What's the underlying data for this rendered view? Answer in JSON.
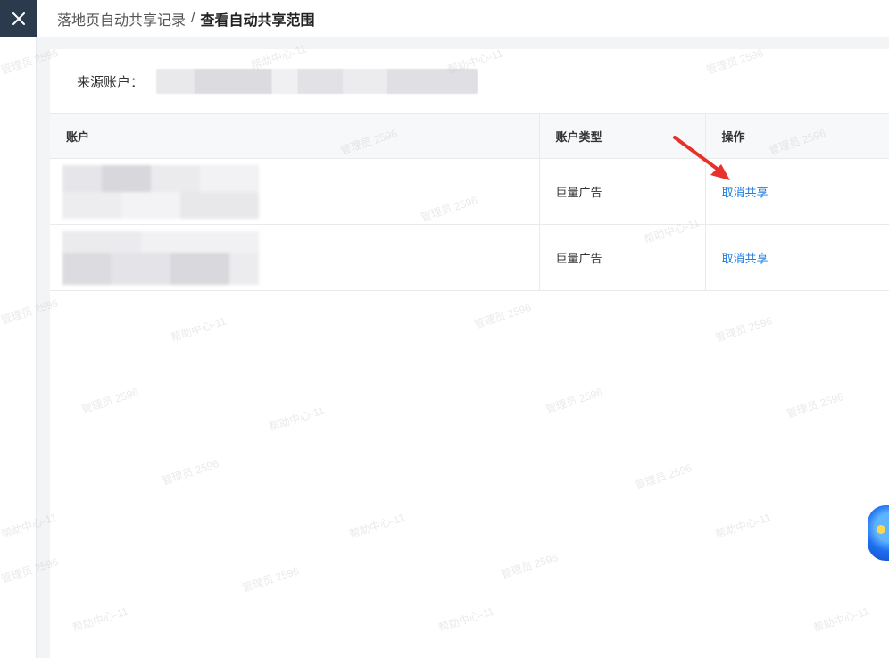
{
  "header": {
    "breadcrumb_parent": "落地页自动共享记录",
    "breadcrumb_separator": "/",
    "breadcrumb_current": "查看自动共享范围"
  },
  "filter": {
    "source_account_label": "来源账户："
  },
  "table": {
    "columns": [
      "账户",
      "账户类型",
      "操作"
    ],
    "rows": [
      {
        "account_type": "巨量广告",
        "action": "取消共享"
      },
      {
        "account_type": "巨量广告",
        "action": "取消共享"
      }
    ]
  },
  "watermark": {
    "text_a": "帮助中心-11",
    "text_b": "管理员 2596"
  },
  "colors": {
    "close_bg": "#2c3a4d",
    "link": "#1f7fe0",
    "arrow": "#e8312a"
  },
  "icons": [
    "close-icon",
    "annotation-arrow-icon",
    "assistant-icon"
  ]
}
